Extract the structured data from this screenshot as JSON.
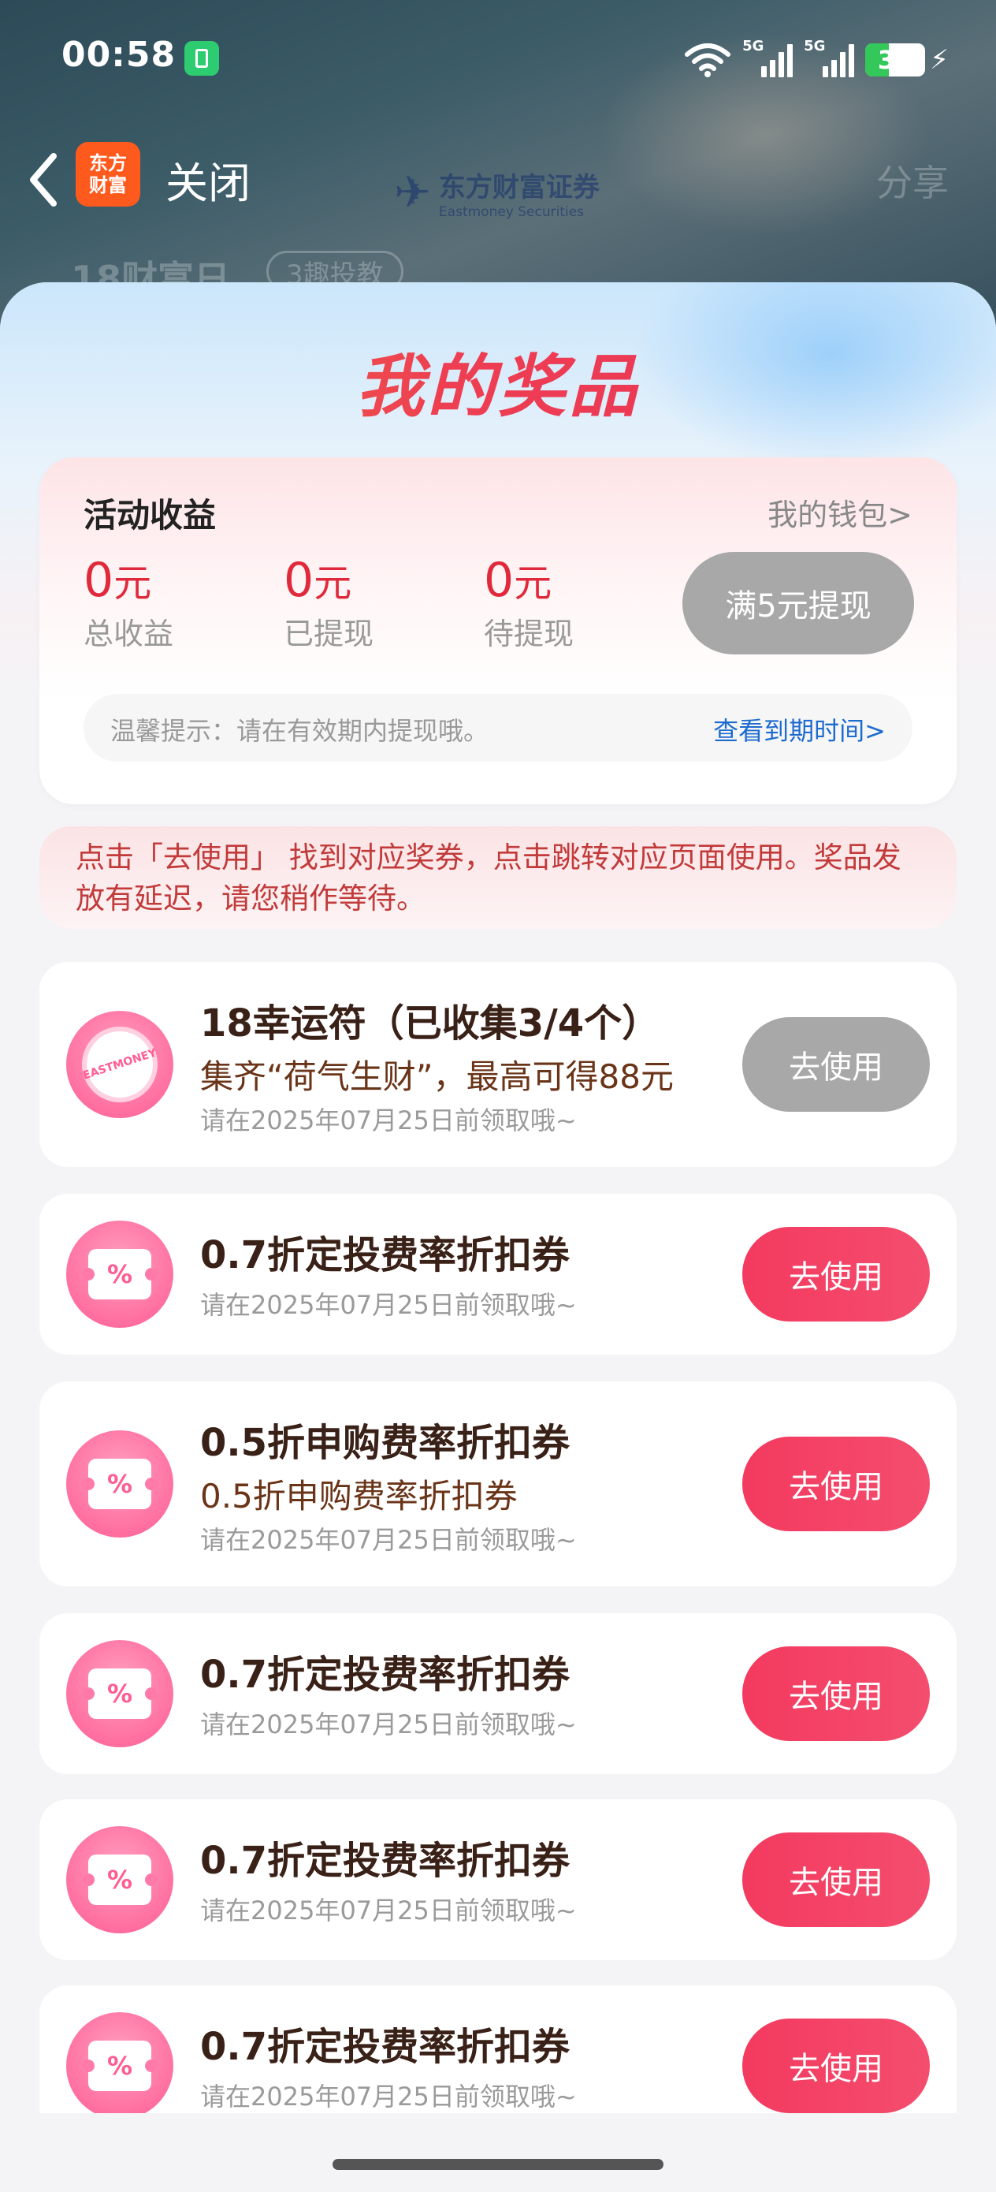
{
  "status_bar": {
    "time": "00:58",
    "network_1": "5G",
    "network_2": "5G",
    "battery_level": "39",
    "battery_percent": 39,
    "charging": true,
    "icons": [
      "app-notification-icon",
      "wifi-icon",
      "signal-icon",
      "signal-icon",
      "battery-icon",
      "charging-bolt-icon"
    ]
  },
  "nav": {
    "back_icon": "chevron-left-icon",
    "logo_line1": "东方",
    "logo_line2": "财富",
    "close_label": "关闭",
    "brand_cn": "东方财富证券",
    "brand_en": "Eastmoney Securities",
    "share_label": "分享"
  },
  "behind": {
    "title": "18财富日",
    "pill": "3趣投教"
  },
  "sheet": {
    "title": "我的奖品",
    "earnings": {
      "title": "活动收益",
      "wallet_link": "我的钱包>",
      "stats": [
        {
          "value": "0",
          "unit": "元",
          "label": "总收益"
        },
        {
          "value": "0",
          "unit": "元",
          "label": "已提现"
        },
        {
          "value": "0",
          "unit": "元",
          "label": "待提现"
        }
      ],
      "withdraw_button": "满5元提现",
      "tip_text": "温馨提示：请在有效期内提现哦。",
      "tip_link": "查看到期时间>"
    },
    "notice": "点击「去使用」 找到对应奖券，点击跳转对应页面使用。奖品发放有延迟，请您稍作等待。",
    "prizes": [
      {
        "title": "18幸运符（已收集3/4个）",
        "desc": "集齐“荷气生财”，最高可得88元",
        "expiry": "请在2025年07月25日前领取哦~",
        "button": "去使用",
        "disabled": true,
        "icon": "eastmoney-badge-icon",
        "badge_text": "EASTMONEY"
      },
      {
        "title": "0.7折定投费率折扣券",
        "desc": "",
        "expiry": "请在2025年07月25日前领取哦~",
        "button": "去使用",
        "disabled": false,
        "icon": "coupon-icon",
        "badge_text": "%"
      },
      {
        "title": "0.5折申购费率折扣券",
        "desc": "0.5折申购费率折扣券",
        "expiry": "请在2025年07月25日前领取哦~",
        "button": "去使用",
        "disabled": false,
        "icon": "coupon-icon",
        "badge_text": "%"
      },
      {
        "title": "0.7折定投费率折扣券",
        "desc": "",
        "expiry": "请在2025年07月25日前领取哦~",
        "button": "去使用",
        "disabled": false,
        "icon": "coupon-icon",
        "badge_text": "%"
      },
      {
        "title": "0.7折定投费率折扣券",
        "desc": "",
        "expiry": "请在2025年07月25日前领取哦~",
        "button": "去使用",
        "disabled": false,
        "icon": "coupon-icon",
        "badge_text": "%"
      },
      {
        "title": "0.7折定投费率折扣券",
        "desc": "",
        "expiry": "请在2025年07月25日前领取哦~",
        "button": "去使用",
        "disabled": false,
        "icon": "coupon-icon",
        "badge_text": "%"
      }
    ]
  },
  "colors": {
    "accent_red": "#e02a3b",
    "button_pink": "#f33a5f",
    "disabled_gray": "#a8a8a8",
    "link_blue": "#1e6bd0",
    "battery_green": "#34c759"
  }
}
